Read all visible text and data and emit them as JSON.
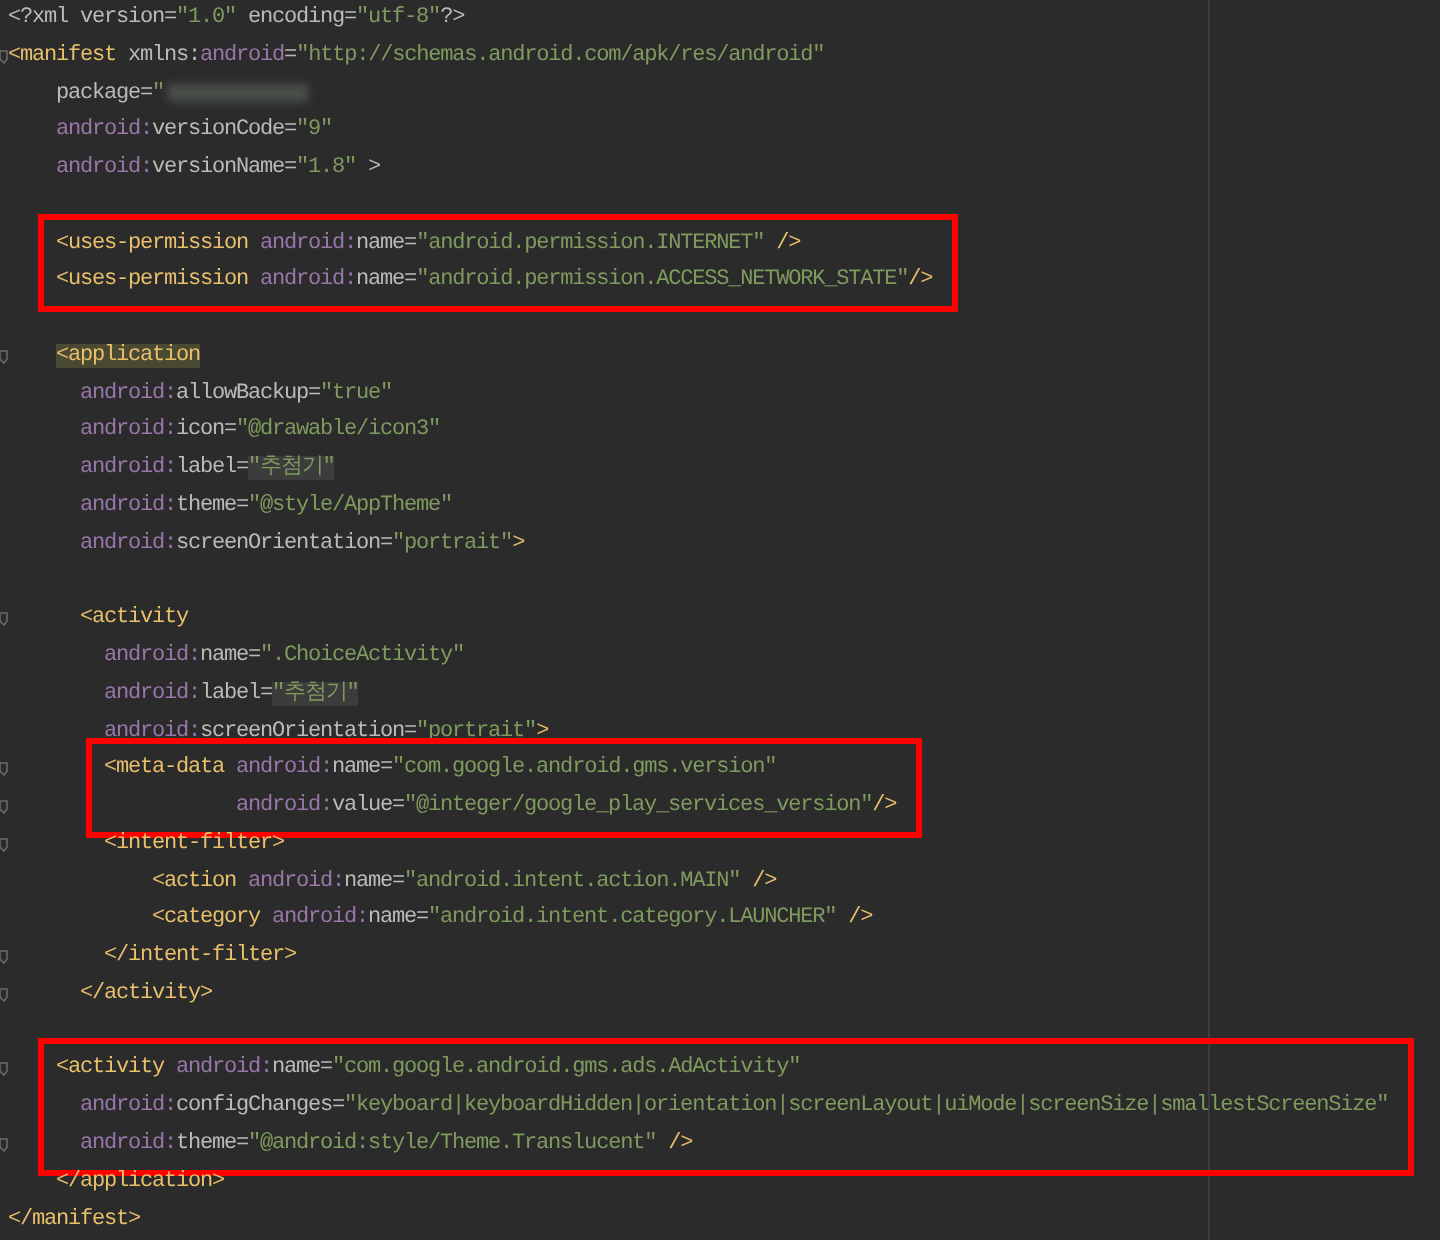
{
  "editor": {
    "lines": [
      {
        "kind": "code",
        "fold": false,
        "boxed": false,
        "tokens": [
          {
            "kind": "text",
            "text": "<?xml version="
          },
          {
            "kind": "value",
            "text": "\"1.0\""
          },
          {
            "kind": "text",
            "text": " encoding="
          },
          {
            "kind": "value",
            "text": "\"utf-8\""
          },
          {
            "kind": "text",
            "text": "?>"
          }
        ]
      },
      {
        "kind": "code",
        "fold": true,
        "boxed": false,
        "tokens": [
          {
            "kind": "tag",
            "text": "<manifest"
          },
          {
            "kind": "text",
            "text": " xmlns:"
          },
          {
            "kind": "ns",
            "text": "android"
          },
          {
            "kind": "text",
            "text": "="
          },
          {
            "kind": "value",
            "text": "\"http://schemas.android.com/apk/res/android\""
          }
        ],
        "children": [
          {
            "kind": "code",
            "fold": false,
            "boxed": false,
            "redacted": true,
            "tokens": [
              {
                "kind": "text",
                "text": "package="
              },
              {
                "kind": "value",
                "text": "\""
              }
            ]
          },
          {
            "kind": "code",
            "fold": false,
            "boxed": false,
            "tokens": [
              {
                "kind": "ns",
                "text": "android:"
              },
              {
                "kind": "text",
                "text": "versionCode="
              },
              {
                "kind": "value",
                "text": "\"9\""
              }
            ]
          },
          {
            "kind": "code",
            "fold": false,
            "boxed": false,
            "tokens": [
              {
                "kind": "ns",
                "text": "android:"
              },
              {
                "kind": "text",
                "text": "versionName="
              },
              {
                "kind": "value",
                "text": "\"1.8\""
              },
              {
                "kind": "text",
                "text": " >"
              }
            ]
          },
          {
            "kind": "blank"
          },
          {
            "kind": "code",
            "fold": false,
            "boxed": true,
            "tokens": [
              {
                "kind": "tag",
                "text": "<uses-permission"
              },
              {
                "kind": "ns",
                "text": " android:"
              },
              {
                "kind": "text",
                "text": "name="
              },
              {
                "kind": "value",
                "text": "\"android.permission.INTERNET\""
              },
              {
                "kind": "tag",
                "text": " />"
              }
            ]
          },
          {
            "kind": "code",
            "fold": false,
            "boxed": true,
            "tokens": [
              {
                "kind": "tag",
                "text": "<uses-permission"
              },
              {
                "kind": "ns",
                "text": " android:"
              },
              {
                "kind": "text",
                "text": "name="
              },
              {
                "kind": "value",
                "text": "\"android.permission.ACCESS_NETWORK_STATE\""
              },
              {
                "kind": "tag",
                "text": "/>"
              }
            ]
          },
          {
            "kind": "blank"
          },
          {
            "kind": "code",
            "fold": true,
            "boxed": false,
            "tokens": [
              {
                "kind": "tag",
                "text": "<application",
                "highlight": true
              }
            ],
            "children": [
              {
                "kind": "code",
                "fold": false,
                "boxed": false,
                "tokens": [
                  {
                    "kind": "ns",
                    "text": "android:"
                  },
                  {
                    "kind": "text",
                    "text": "allowBackup="
                  },
                  {
                    "kind": "value",
                    "text": "\"true\""
                  }
                ]
              },
              {
                "kind": "code",
                "fold": false,
                "boxed": false,
                "tokens": [
                  {
                    "kind": "ns",
                    "text": "android:"
                  },
                  {
                    "kind": "text",
                    "text": "icon="
                  },
                  {
                    "kind": "value",
                    "text": "\"@drawable/icon3\""
                  }
                ]
              },
              {
                "kind": "code",
                "fold": false,
                "boxed": false,
                "tokens": [
                  {
                    "kind": "ns",
                    "text": "android:"
                  },
                  {
                    "kind": "text",
                    "text": "label="
                  },
                  {
                    "kind": "value",
                    "text": "\"추첨기\"",
                    "highlight": true
                  }
                ]
              },
              {
                "kind": "code",
                "fold": false,
                "boxed": false,
                "tokens": [
                  {
                    "kind": "ns",
                    "text": "android:"
                  },
                  {
                    "kind": "text",
                    "text": "theme="
                  },
                  {
                    "kind": "value",
                    "text": "\"@style/AppTheme\""
                  }
                ]
              },
              {
                "kind": "code",
                "fold": false,
                "boxed": false,
                "tokens": [
                  {
                    "kind": "ns",
                    "text": "android:"
                  },
                  {
                    "kind": "text",
                    "text": "screenOrientation="
                  },
                  {
                    "kind": "value",
                    "text": "\"portrait\""
                  },
                  {
                    "kind": "tag",
                    "text": ">"
                  }
                ]
              },
              {
                "kind": "blank"
              },
              {
                "kind": "code",
                "fold": true,
                "boxed": false,
                "tokens": [
                  {
                    "kind": "tag",
                    "text": "<activity"
                  }
                ],
                "children": [
                  {
                    "kind": "code",
                    "fold": false,
                    "boxed": false,
                    "tokens": [
                      {
                        "kind": "ns",
                        "text": "android:"
                      },
                      {
                        "kind": "text",
                        "text": "name="
                      },
                      {
                        "kind": "value",
                        "text": "\".ChoiceActivity\""
                      }
                    ]
                  },
                  {
                    "kind": "code",
                    "fold": false,
                    "boxed": false,
                    "tokens": [
                      {
                        "kind": "ns",
                        "text": "android:"
                      },
                      {
                        "kind": "text",
                        "text": "label="
                      },
                      {
                        "kind": "value",
                        "text": "\"추첨기\"",
                        "highlight": true
                      }
                    ]
                  },
                  {
                    "kind": "code",
                    "fold": false,
                    "boxed": false,
                    "tokens": [
                      {
                        "kind": "ns",
                        "text": "android:"
                      },
                      {
                        "kind": "text",
                        "text": "screenOrientation="
                      },
                      {
                        "kind": "value",
                        "text": "\"portrait\""
                      },
                      {
                        "kind": "tag",
                        "text": ">"
                      }
                    ]
                  },
                  {
                    "kind": "code",
                    "fold": true,
                    "boxed": true,
                    "tokens": [
                      {
                        "kind": "tag",
                        "text": "<meta-data"
                      },
                      {
                        "kind": "ns",
                        "text": " android:"
                      },
                      {
                        "kind": "text",
                        "text": "name="
                      },
                      {
                        "kind": "value",
                        "text": "\"com.google.android.gms.version\""
                      }
                    ],
                    "children": [
                      {
                        "kind": "continuation",
                        "fold": true,
                        "boxed": true,
                        "tokens": [
                          {
                            "kind": "ns",
                            "text": "android:"
                          },
                          {
                            "kind": "text",
                            "text": "value="
                          },
                          {
                            "kind": "value",
                            "text": "\"@integer/google_play_services_version\""
                          },
                          {
                            "kind": "tag",
                            "text": "/>"
                          }
                        ]
                      }
                    ]
                  },
                  {
                    "kind": "code",
                    "fold": true,
                    "boxed": false,
                    "tokens": [
                      {
                        "kind": "tag",
                        "text": "<intent-filter>"
                      }
                    ],
                    "children": [
                      {
                        "kind": "code",
                        "fold": false,
                        "boxed": false,
                        "tokens": [
                          {
                            "kind": "tag",
                            "text": "<action"
                          },
                          {
                            "kind": "ns",
                            "text": " android:"
                          },
                          {
                            "kind": "text",
                            "text": "name="
                          },
                          {
                            "kind": "value",
                            "text": "\"android.intent.action.MAIN\""
                          },
                          {
                            "kind": "tag",
                            "text": " />"
                          }
                        ]
                      },
                      {
                        "kind": "code",
                        "fold": false,
                        "boxed": false,
                        "tokens": [
                          {
                            "kind": "tag",
                            "text": "<category"
                          },
                          {
                            "kind": "ns",
                            "text": " android:"
                          },
                          {
                            "kind": "text",
                            "text": "name="
                          },
                          {
                            "kind": "value",
                            "text": "\"android.intent.category.LAUNCHER\""
                          },
                          {
                            "kind": "tag",
                            "text": " />"
                          }
                        ]
                      }
                    ]
                  },
                  {
                    "kind": "code",
                    "fold": true,
                    "boxed": false,
                    "tokens": [
                      {
                        "kind": "tag",
                        "text": "</intent-filter>"
                      }
                    ]
                  }
                ]
              },
              {
                "kind": "code",
                "fold": true,
                "boxed": false,
                "tokens": [
                  {
                    "kind": "tag",
                    "text": "</activity>"
                  }
                ]
              }
            ]
          },
          {
            "kind": "blank"
          },
          {
            "kind": "code",
            "fold": true,
            "boxed": true,
            "tokens": [
              {
                "kind": "tag",
                "text": "<activity"
              },
              {
                "kind": "ns",
                "text": " android:"
              },
              {
                "kind": "text",
                "text": "name="
              },
              {
                "kind": "value",
                "text": "\"com.google.android.gms.ads.AdActivity\""
              }
            ],
            "children": [
              {
                "kind": "code",
                "fold": false,
                "boxed": true,
                "tokens": [
                  {
                    "kind": "ns",
                    "text": "android:"
                  },
                  {
                    "kind": "text",
                    "text": "configChanges="
                  },
                  {
                    "kind": "value",
                    "text": "\"keyboard|keyboardHidden|orientation|screenLayout|uiMode|screenSize|smallestScreenSize\""
                  }
                ]
              },
              {
                "kind": "code",
                "fold": true,
                "boxed": true,
                "tokens": [
                  {
                    "kind": "ns",
                    "text": "android:"
                  },
                  {
                    "kind": "text",
                    "text": "theme="
                  },
                  {
                    "kind": "value",
                    "text": "\"@android:style/Theme.Translucent\""
                  },
                  {
                    "kind": "tag",
                    "text": " />"
                  }
                ]
              }
            ]
          },
          {
            "kind": "code",
            "fold": false,
            "boxed": false,
            "tokens": [
              {
                "kind": "tag",
                "text": "</application>"
              }
            ]
          }
        ]
      },
      {
        "kind": "code",
        "fold": false,
        "boxed": false,
        "tokens": [
          {
            "kind": "tag",
            "text": "</manifest>"
          }
        ]
      }
    ]
  }
}
